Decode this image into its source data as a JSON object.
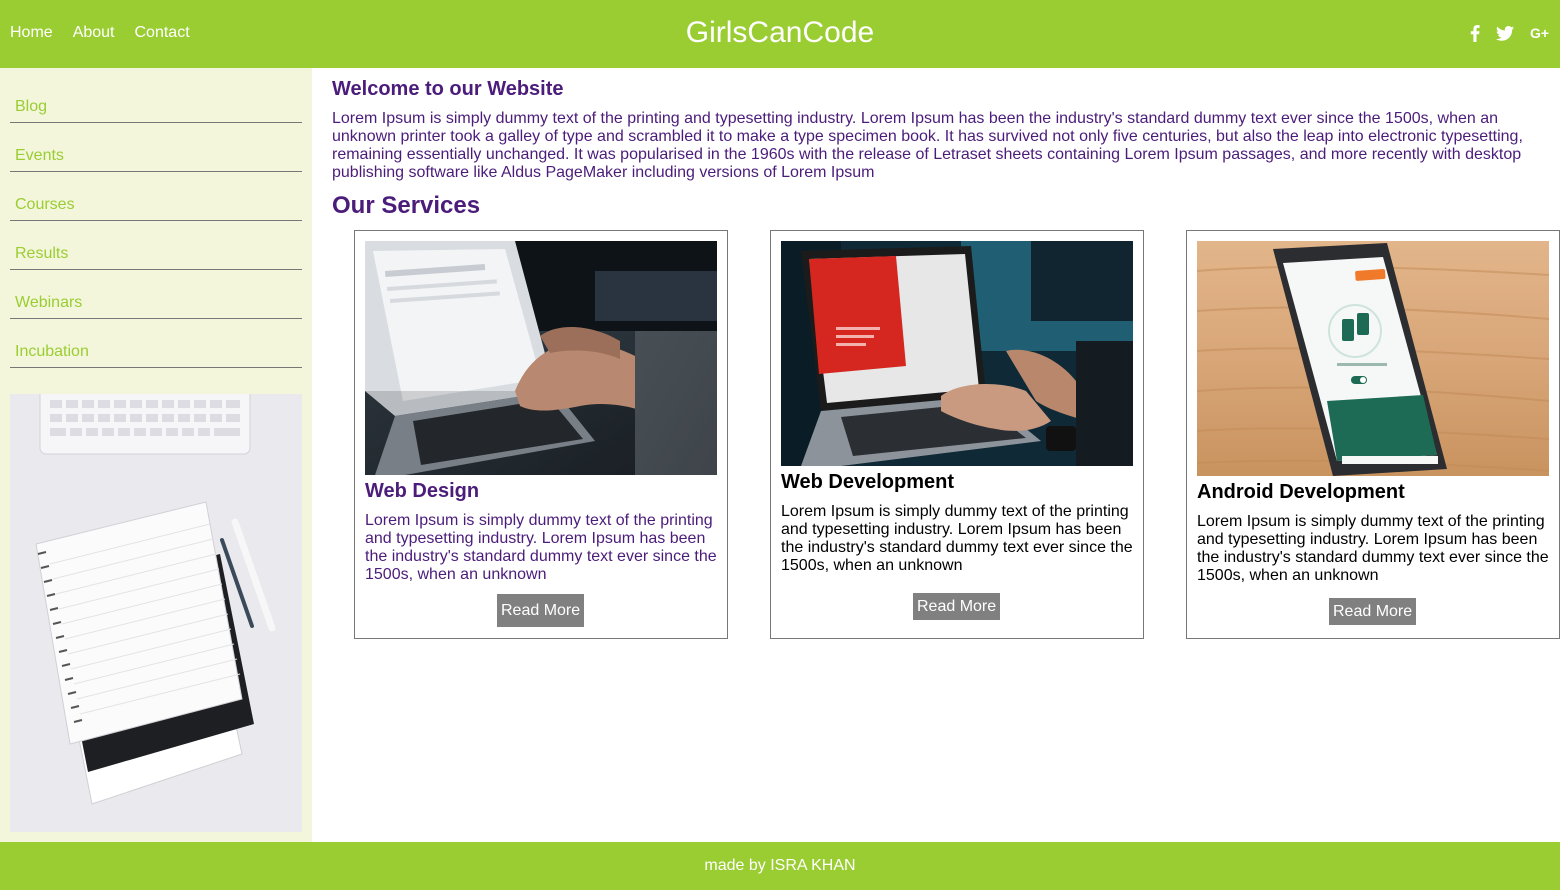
{
  "header": {
    "nav": [
      "Home",
      "About",
      "Contact"
    ],
    "brand": "GirlsCanCode",
    "social": [
      {
        "icon": "facebook-icon",
        "glyph": "f"
      },
      {
        "icon": "twitter-icon",
        "glyph": "twitter"
      },
      {
        "icon": "google-plus-icon",
        "glyph": "G+"
      }
    ]
  },
  "sidebar": {
    "items": [
      "Blog",
      "Events",
      "Courses",
      "Results",
      "Webinars",
      "Incubation"
    ]
  },
  "main": {
    "welcome_title": "Welcome to our Website",
    "welcome_text": "Lorem Ipsum is simply dummy text of the printing and typesetting industry. Lorem Ipsum has been the industry's standard dummy text ever since the 1500s, when an unknown printer took a galley of type and scrambled it to make a type specimen book. It has survived not only five centuries, but also the leap into electronic typesetting, remaining essentially unchanged. It was popularised in the 1960s with the release of Letraset sheets containing Lorem Ipsum passages, and more recently with desktop publishing software like Aldus PageMaker including versions of Lorem Ipsum",
    "services_title": "Our Services",
    "cards": [
      {
        "title": "Web Design",
        "text": "Lorem Ipsum is simply dummy text of the printing and typesetting industry. Lorem Ipsum has been the industry's standard dummy text ever since the 1500s, when an unknown",
        "button": "Read More"
      },
      {
        "title": "Web Development",
        "text": "Lorem Ipsum is simply dummy text of the printing and typesetting industry. Lorem Ipsum has been the industry's standard dummy text ever since the 1500s, when an unknown",
        "button": "Read More"
      },
      {
        "title": "Android Development",
        "text": "Lorem Ipsum is simply dummy text of the printing and typesetting industry. Lorem Ipsum has been the industry's standard dummy text ever since the 1500s, when an unknown",
        "button": "Read More"
      }
    ]
  },
  "footer": {
    "text": "made by ISRA KHAN"
  },
  "colors": {
    "accent": "#9acd32",
    "sidebar_bg": "#f4f6dc",
    "heading_purple": "#4b1c7a",
    "button_gray": "#808080"
  }
}
